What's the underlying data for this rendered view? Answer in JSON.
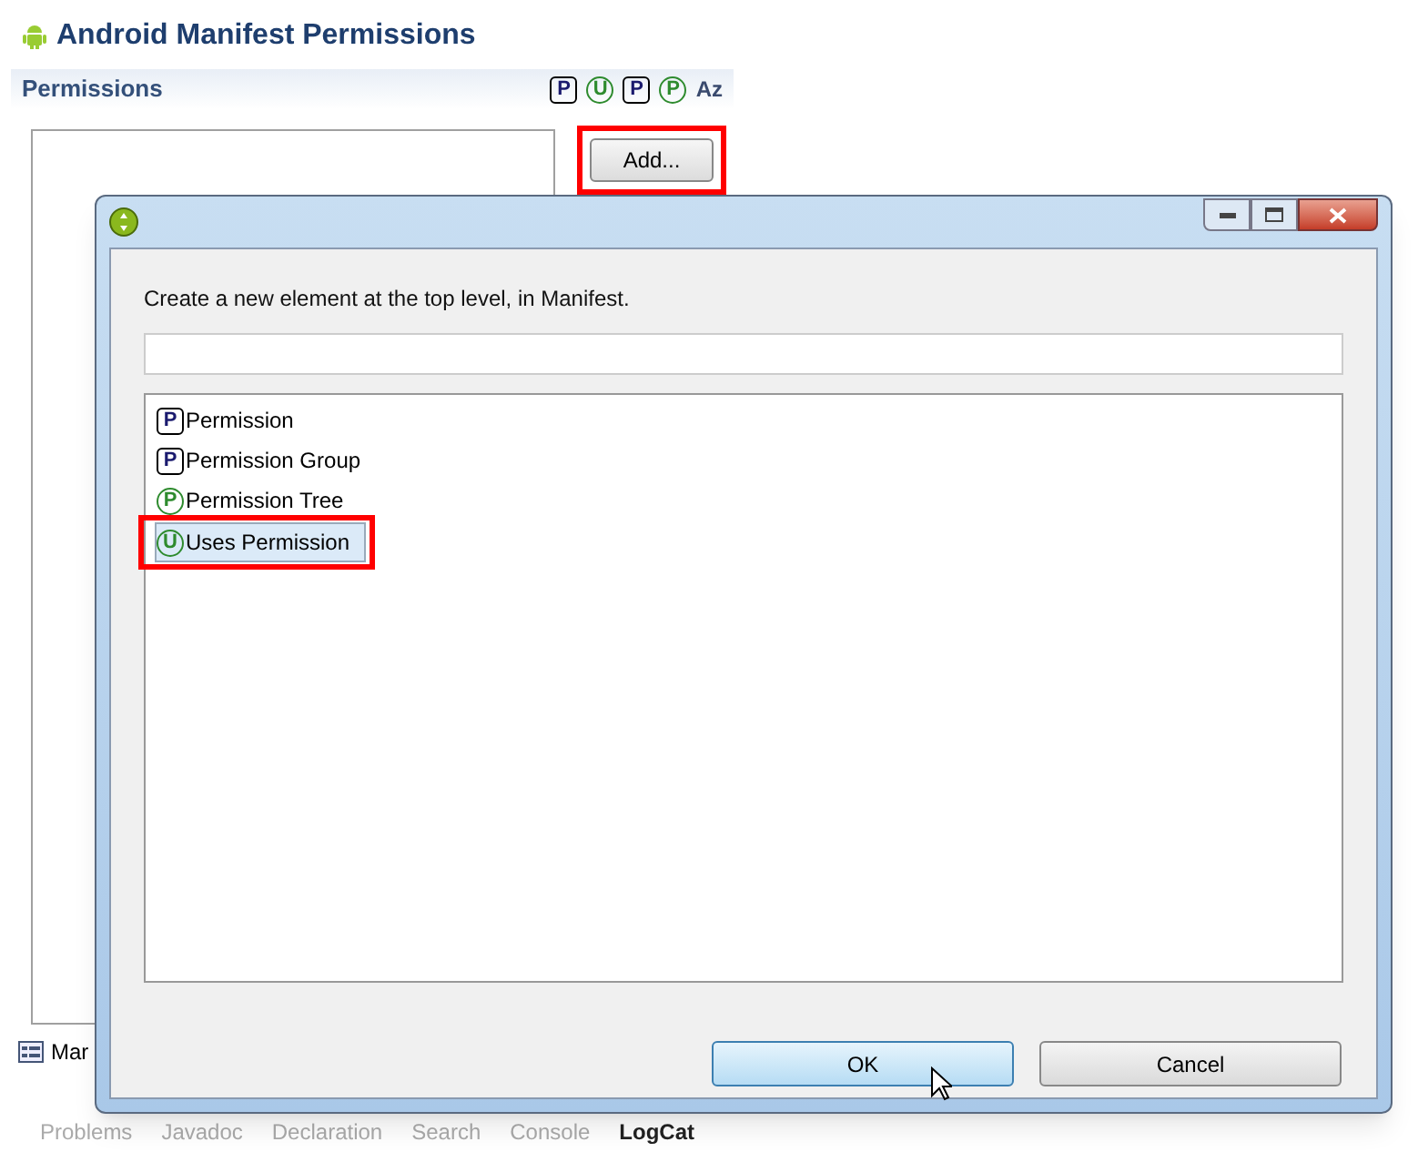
{
  "editor": {
    "title": "Android Manifest Permissions",
    "section": {
      "title": "Permissions",
      "tools": [
        {
          "glyph": "P",
          "kind": "square"
        },
        {
          "glyph": "U",
          "kind": "circle"
        },
        {
          "glyph": "P",
          "kind": "square"
        },
        {
          "glyph": "P",
          "kind": "circle"
        },
        {
          "glyph": "Az",
          "kind": "plain"
        }
      ],
      "add_button": {
        "label": "Add...",
        "highlighted": true
      }
    },
    "bottom_tab": {
      "label": "Mar"
    },
    "views": [
      {
        "label": "Problems",
        "selected": false
      },
      {
        "label": "Javadoc",
        "selected": false
      },
      {
        "label": "Declaration",
        "selected": false
      },
      {
        "label": "Search",
        "selected": false
      },
      {
        "label": "Console",
        "selected": false
      },
      {
        "label": "LogCat",
        "selected": true
      }
    ]
  },
  "dialog": {
    "prompt": "Create a new element at the top level, in Manifest.",
    "items": [
      {
        "label": "Permission",
        "glyph": "P",
        "kind": "square",
        "selected": false,
        "highlighted": false
      },
      {
        "label": "Permission Group",
        "glyph": "P",
        "kind": "square",
        "selected": false,
        "highlighted": false
      },
      {
        "label": "Permission Tree",
        "glyph": "P",
        "kind": "circle",
        "selected": false,
        "highlighted": false
      },
      {
        "label": "Uses Permission",
        "glyph": "U",
        "kind": "circle",
        "selected": true,
        "highlighted": true
      }
    ],
    "buttons": [
      {
        "label": "OK",
        "kind": "default"
      },
      {
        "label": "Cancel",
        "kind": "normal"
      }
    ]
  }
}
